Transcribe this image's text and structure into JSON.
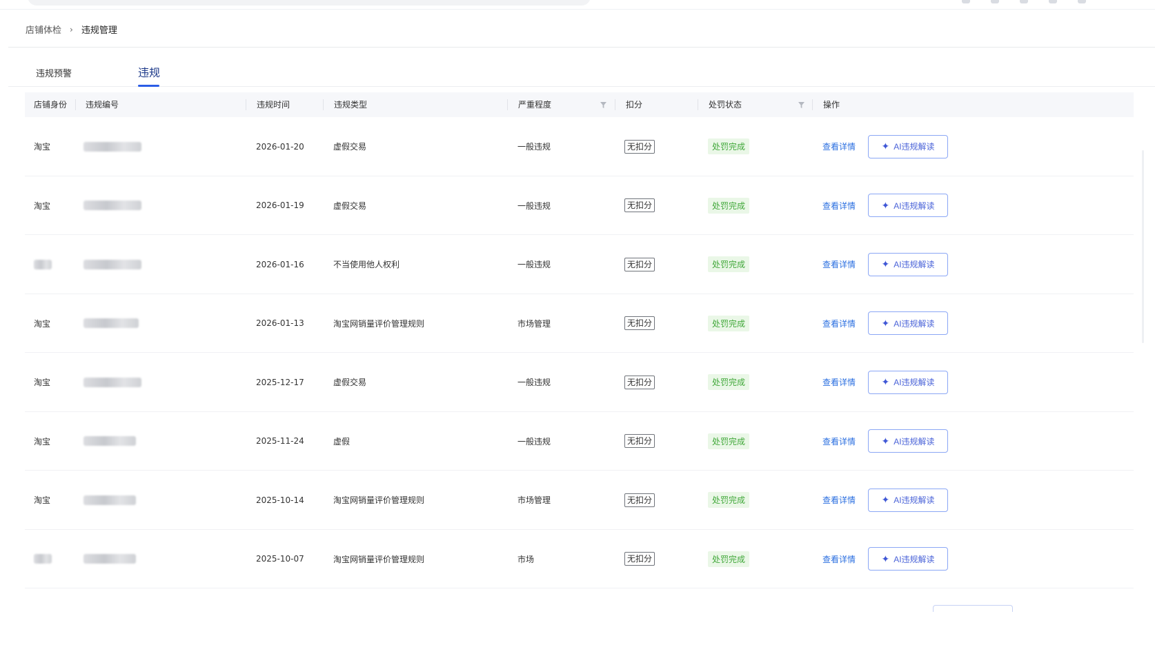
{
  "breadcrumb": {
    "parent": "店铺体检",
    "separator": "›",
    "current": "违规管理"
  },
  "tabs": [
    {
      "label": "违规预警",
      "active": false
    },
    {
      "label": "违规",
      "active": true
    }
  ],
  "table": {
    "columns": [
      "店铺身份",
      "违规编号",
      "违规时间",
      "违规类型",
      "严重程度",
      "扣分",
      "处罚状态",
      "操作"
    ],
    "rows": [
      {
        "identity": "淘宝",
        "id": "",
        "date": "2026-01-20",
        "type": "虚假交易",
        "severity": "一般违规",
        "score": "无扣分",
        "status": "处罚完成",
        "detail": "查看详情",
        "ai": "AI违规解读"
      },
      {
        "identity": "淘宝",
        "id": "",
        "date": "2026-01-19",
        "type": "虚假交易",
        "severity": "一般违规",
        "score": "无扣分",
        "status": "处罚完成",
        "detail": "查看详情",
        "ai": "AI违规解读"
      },
      {
        "identity": "",
        "id": "",
        "date": "2026-01-16",
        "type": "不当使用他人权利",
        "severity": "一般违规",
        "score": "无扣分",
        "status": "处罚完成",
        "detail": "查看详情",
        "ai": "AI违规解读"
      },
      {
        "identity": "淘宝",
        "id": "",
        "date": "2026-01-13",
        "type": "淘宝网销量评价管理规则",
        "severity": "市场管理",
        "score": "无扣分",
        "status": "处罚完成",
        "detail": "查看详情",
        "ai": "AI违规解读"
      },
      {
        "identity": "淘宝",
        "id": "",
        "date": "2025-12-17",
        "type": "虚假交易",
        "severity": "一般违规",
        "score": "无扣分",
        "status": "处罚完成",
        "detail": "查看详情",
        "ai": "AI违规解读"
      },
      {
        "identity": "淘宝",
        "id": "",
        "date": "2025-11-24",
        "type": "虚假",
        "severity": "一般违规",
        "score": "无扣分",
        "status": "处罚完成",
        "detail": "查看详情",
        "ai": "AI违规解读"
      },
      {
        "identity": "淘宝",
        "id": "",
        "date": "2025-10-14",
        "type": "淘宝网销量评价管理规则",
        "severity": "市场管理",
        "score": "无扣分",
        "status": "处罚完成",
        "detail": "查看详情",
        "ai": "AI违规解读"
      },
      {
        "identity": "",
        "id": "",
        "date": "2025-10-07",
        "type": "淘宝网销量评价管理规则",
        "severity": "市场",
        "score": "无扣分",
        "status": "处罚完成",
        "detail": "查看详情",
        "ai": "AI违规解读"
      }
    ]
  },
  "icons": {
    "filter": "filter-icon",
    "ai_sparkle": "sparkle-icon",
    "breadcrumb_separator": "chevron-right-icon"
  },
  "colors": {
    "accent": "#2b5de6",
    "link": "#2b6fe0",
    "status_bg": "#eaf7e7",
    "status_text": "#41a83a",
    "header_bg": "#f6f7fa"
  }
}
